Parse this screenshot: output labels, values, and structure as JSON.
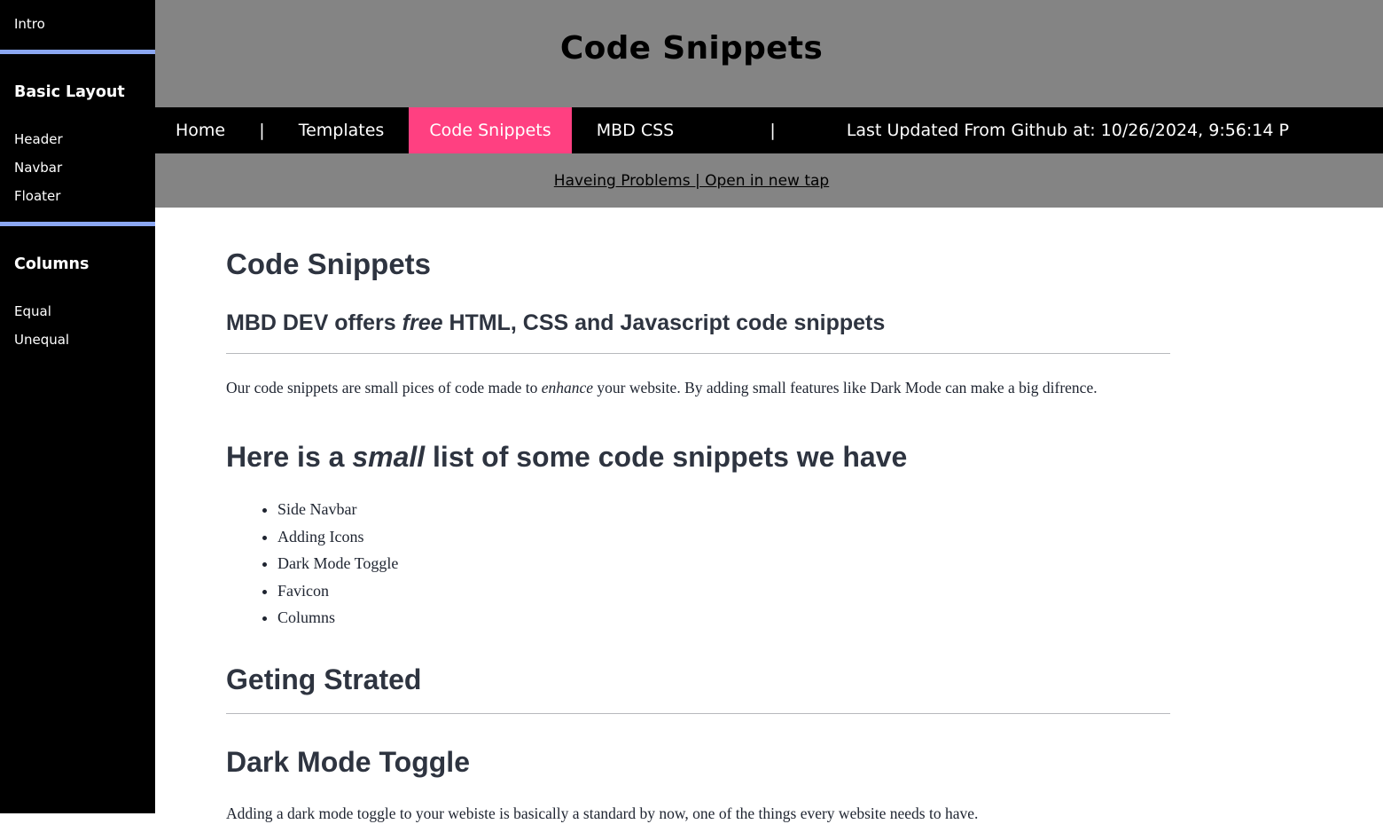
{
  "sidebar": {
    "intro": {
      "label": "Intro"
    },
    "groups": [
      {
        "heading": "Basic Layout",
        "items": [
          {
            "label": "Header"
          },
          {
            "label": "Navbar"
          },
          {
            "label": "Floater"
          }
        ]
      },
      {
        "heading": "Columns",
        "items": [
          {
            "label": "Equal"
          },
          {
            "label": "Unequal"
          }
        ]
      }
    ]
  },
  "header": {
    "title": "Code Snippets",
    "background_color": "#848484",
    "text_color": "#000000"
  },
  "navbar": {
    "background_color": "#000000",
    "active_color": "#ff4081",
    "items": [
      {
        "label": "Home",
        "active": false
      },
      {
        "label": "Templates",
        "active": false
      },
      {
        "label": "Code Snippets",
        "active": true
      },
      {
        "label": "MBD CSS",
        "active": false
      }
    ],
    "separator": "|",
    "status": "Last Updated From Github at: 10/26/2024, 9:56:14 P"
  },
  "subbar": {
    "link_text": "Haveing Problems  |  Open in new tap",
    "background_color": "#848484"
  },
  "article": {
    "page_heading": "Code Snippets",
    "tagline_prefix": "MBD DEV offers ",
    "tagline_em": "free",
    "tagline_suffix": " HTML, CSS and Javascript code snippets",
    "intro_prefix": "Our code snippets are small pices of code made to ",
    "intro_em": "enhance",
    "intro_suffix": " your website. By adding small features like Dark Mode can make a big difrence.",
    "list_heading_prefix": "Here is a ",
    "list_heading_em": "small",
    "list_heading_suffix": " list of some code snippets we have",
    "snippets": [
      {
        "label": "Side Navbar"
      },
      {
        "label": "Adding Icons"
      },
      {
        "label": "Dark Mode Toggle"
      },
      {
        "label": "Favicon"
      },
      {
        "label": "Columns"
      }
    ],
    "getting_started_heading": "Geting Strated",
    "dark_mode_heading": "Dark Mode Toggle",
    "dark_mode_text": "Adding a dark mode toggle to your webiste is basically a standard by now, one of the things every website needs to have."
  }
}
